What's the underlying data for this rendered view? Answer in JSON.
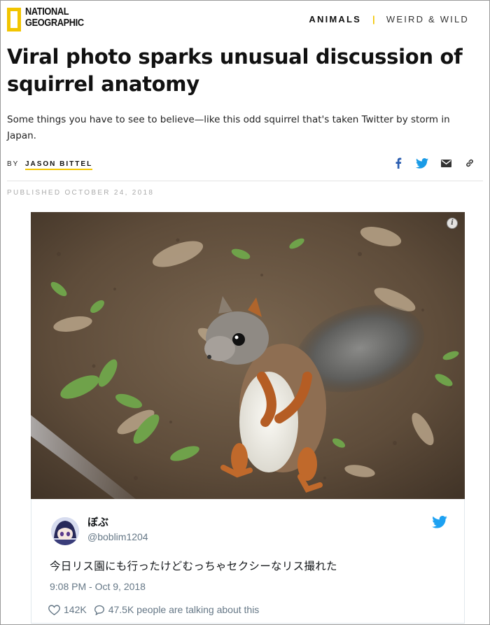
{
  "brand": {
    "line1": "NATIONAL",
    "line2": "GEOGRAPHIC",
    "accent_color": "#f2c500"
  },
  "nav": {
    "section": "ANIMALS",
    "separator": "|",
    "subsection": "WEIRD & WILD"
  },
  "article": {
    "headline": "Viral photo sparks unusual discussion of squirrel anatomy",
    "dek": "Some things you have to see to believe—like this odd squirrel that's taken Twitter by storm in Japan.",
    "by_label": "BY",
    "author": "JASON BITTEL",
    "published": "PUBLISHED OCTOBER 24, 2018"
  },
  "share": {
    "icons": [
      "facebook-icon",
      "twitter-icon",
      "email-icon",
      "link-icon"
    ]
  },
  "photo": {
    "info_label": "i",
    "subject": "squirrel-photo"
  },
  "tweet": {
    "name": "ぼぶ",
    "handle": "@boblim1204",
    "text": "今日リス園にも行ったけどむっちゃセクシーなリス撮れた",
    "time": "9:08 PM - Oct 9, 2018",
    "likes": "142K",
    "talking": "47.5K people are talking about this",
    "brand_color": "#1da1f2"
  }
}
